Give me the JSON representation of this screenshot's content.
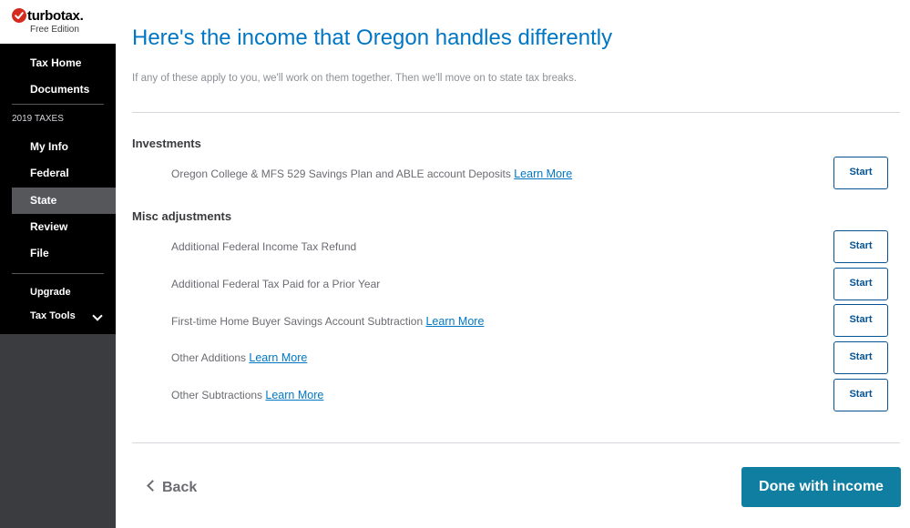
{
  "brand": {
    "wordmark": "turbotax.",
    "edition": "Free Edition",
    "icon": "checkmark-circle-icon",
    "accent": "#d52b1e"
  },
  "sidebar": {
    "items_top": [
      {
        "label": "Tax Home"
      },
      {
        "label": "Documents"
      }
    ],
    "section_label": "2019 TAXES",
    "items_taxes": [
      {
        "label": "My Info",
        "active": false
      },
      {
        "label": "Federal",
        "active": false
      },
      {
        "label": "State",
        "active": true
      },
      {
        "label": "Review",
        "active": false
      },
      {
        "label": "File",
        "active": false
      }
    ],
    "items_bottom": [
      {
        "label": "Upgrade"
      },
      {
        "label": "Tax Tools",
        "icon": "chevron-down-icon"
      }
    ]
  },
  "main": {
    "title": "Here's the income that Oregon handles differently",
    "subtitle": "If any of these apply to you, we'll work on them together. Then we'll move on to state tax breaks.",
    "sections": [
      {
        "heading": "Investments",
        "rows": [
          {
            "text": "Oregon College & MFS 529 Savings Plan and ABLE account Deposits",
            "link": "Learn More",
            "button": "Start"
          }
        ]
      },
      {
        "heading": "Misc adjustments",
        "rows": [
          {
            "text": "Additional Federal Income Tax Refund",
            "link": "",
            "button": "Start"
          },
          {
            "text": "Additional Federal Tax Paid for a Prior Year",
            "link": "",
            "button": "Start"
          },
          {
            "text": "First-time Home Buyer Savings Account Subtraction",
            "link": "Learn More",
            "button": "Start"
          },
          {
            "text": "Other Additions",
            "link": "Learn More",
            "button": "Start"
          },
          {
            "text": "Other Subtractions",
            "link": "Learn More",
            "button": "Start"
          }
        ]
      }
    ],
    "back_label": "Back",
    "done_label": "Done with income"
  },
  "colors": {
    "title_blue": "#0077c5",
    "button_teal": "#0f7ea1",
    "sidebar_bg": "#000000",
    "sidebar_active": "#55575b"
  }
}
